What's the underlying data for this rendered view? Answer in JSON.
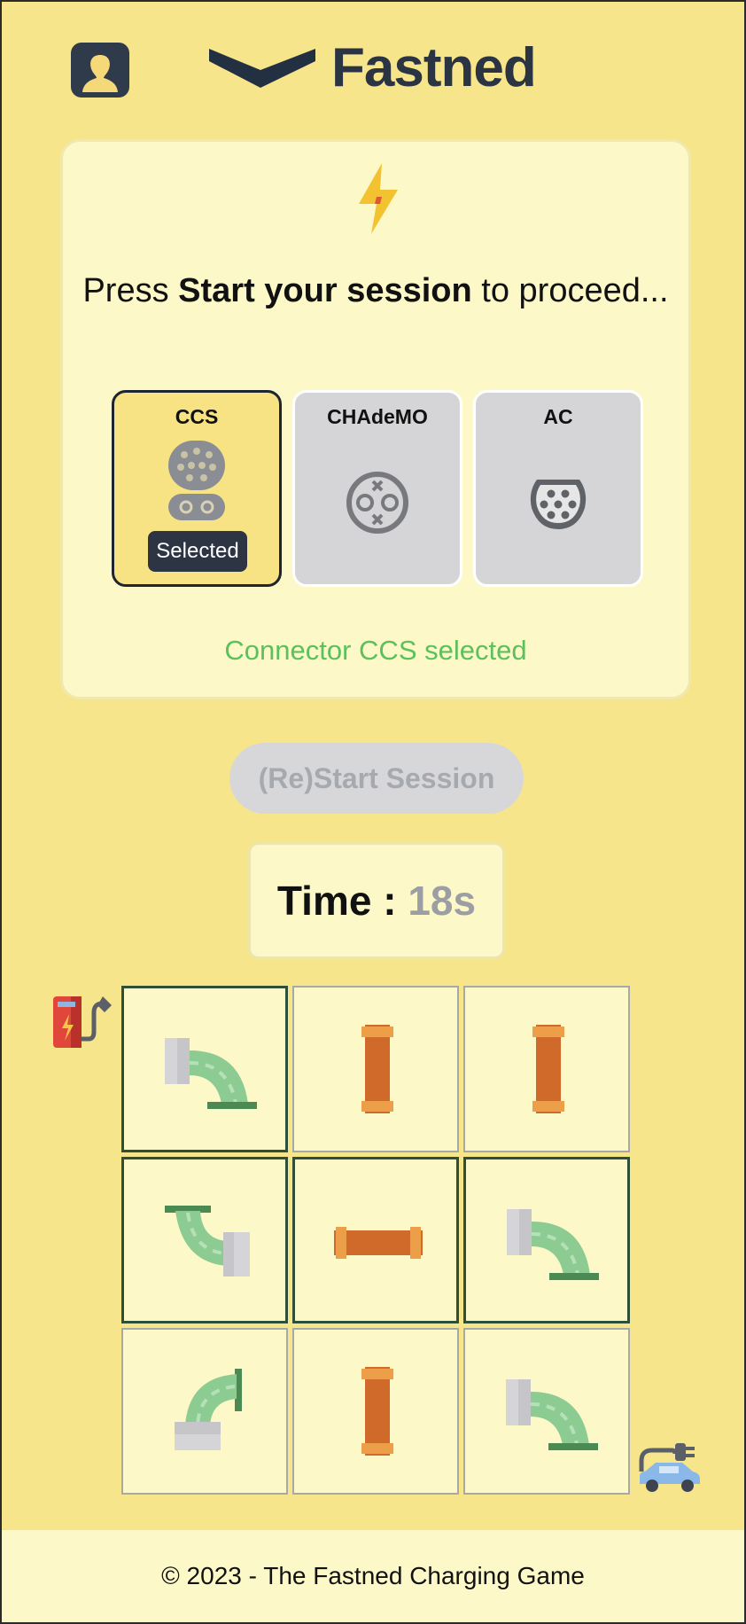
{
  "header": {
    "brand": "Fastned",
    "avatar_icon": "user-avatar-icon",
    "logo_icon": "fastned-chevron-logo"
  },
  "card": {
    "bolt_icon": "lightning-bolt-icon",
    "instruction_prefix": "Press ",
    "instruction_bold": "Start your session",
    "instruction_suffix": " to proceed...",
    "connectors": [
      {
        "label": "CCS",
        "icon": "ccs-plug-icon",
        "selected": true
      },
      {
        "label": "CHAdeMO",
        "icon": "chademo-plug-icon",
        "selected": false
      },
      {
        "label": "AC",
        "icon": "type2-ac-plug-icon",
        "selected": false
      }
    ],
    "selected_badge": "Selected",
    "status": "Connector CCS selected",
    "status_color": "#5cc05c"
  },
  "controls": {
    "start_label": "(Re)Start Session",
    "start_disabled": true
  },
  "timer": {
    "label": "Time : ",
    "value": "18s"
  },
  "grid": {
    "rows": 3,
    "cols": 3,
    "start_icon": "charging-station-icon",
    "end_icon": "electric-car-icon",
    "tiles": [
      {
        "type": "elbow",
        "color": "green",
        "rotation": 0,
        "connected": true
      },
      {
        "type": "straight",
        "color": "orange",
        "rotation": 0,
        "connected": false
      },
      {
        "type": "straight",
        "color": "orange",
        "rotation": 0,
        "connected": false
      },
      {
        "type": "elbow",
        "color": "green",
        "rotation": 90,
        "connected": true
      },
      {
        "type": "straight",
        "color": "orange",
        "rotation": 90,
        "connected": true
      },
      {
        "type": "elbow",
        "color": "green",
        "rotation": 0,
        "connected": true
      },
      {
        "type": "elbow",
        "color": "green",
        "rotation": 270,
        "connected": false
      },
      {
        "type": "straight",
        "color": "orange",
        "rotation": 0,
        "connected": false
      },
      {
        "type": "elbow",
        "color": "green",
        "rotation": 0,
        "connected": false
      }
    ]
  },
  "footer": {
    "text": "© 2023 - The Fastned Charging Game"
  }
}
